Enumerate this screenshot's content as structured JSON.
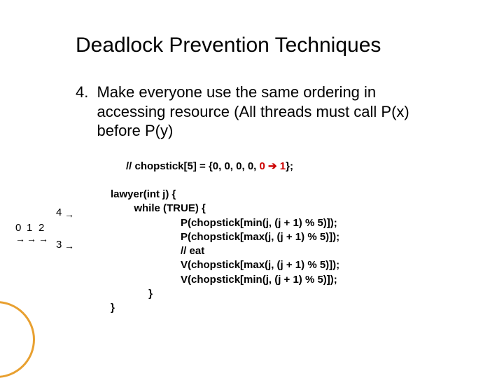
{
  "title": "Deadlock Prevention Techniques",
  "bullet": {
    "num": "4.",
    "text": "Make everyone use the same ordering in accessing resource (All threads must call P(x) before P(y)"
  },
  "comment": {
    "prefix": "// chopstick[5] = {0, 0, 0, 0, ",
    "old": "0",
    "arrow": "➔",
    "new": "1",
    "suffix": "};"
  },
  "code": "lawyer(int j) {\n        while (TRUE) {\n                        P(chopstick[min(j, (j + 1) % 5)]);\n                        P(chopstick[max(j, (j + 1) % 5)]);\n                        // eat\n                        V(chopstick[max(j, (j + 1) % 5)]);\n                        V(chopstick[min(j, (j + 1) % 5)]);\n             }\n}",
  "diagram": {
    "n0": "0",
    "n1": "1",
    "n2": "2",
    "n3": "3",
    "n4": "4",
    "arr": "→"
  }
}
